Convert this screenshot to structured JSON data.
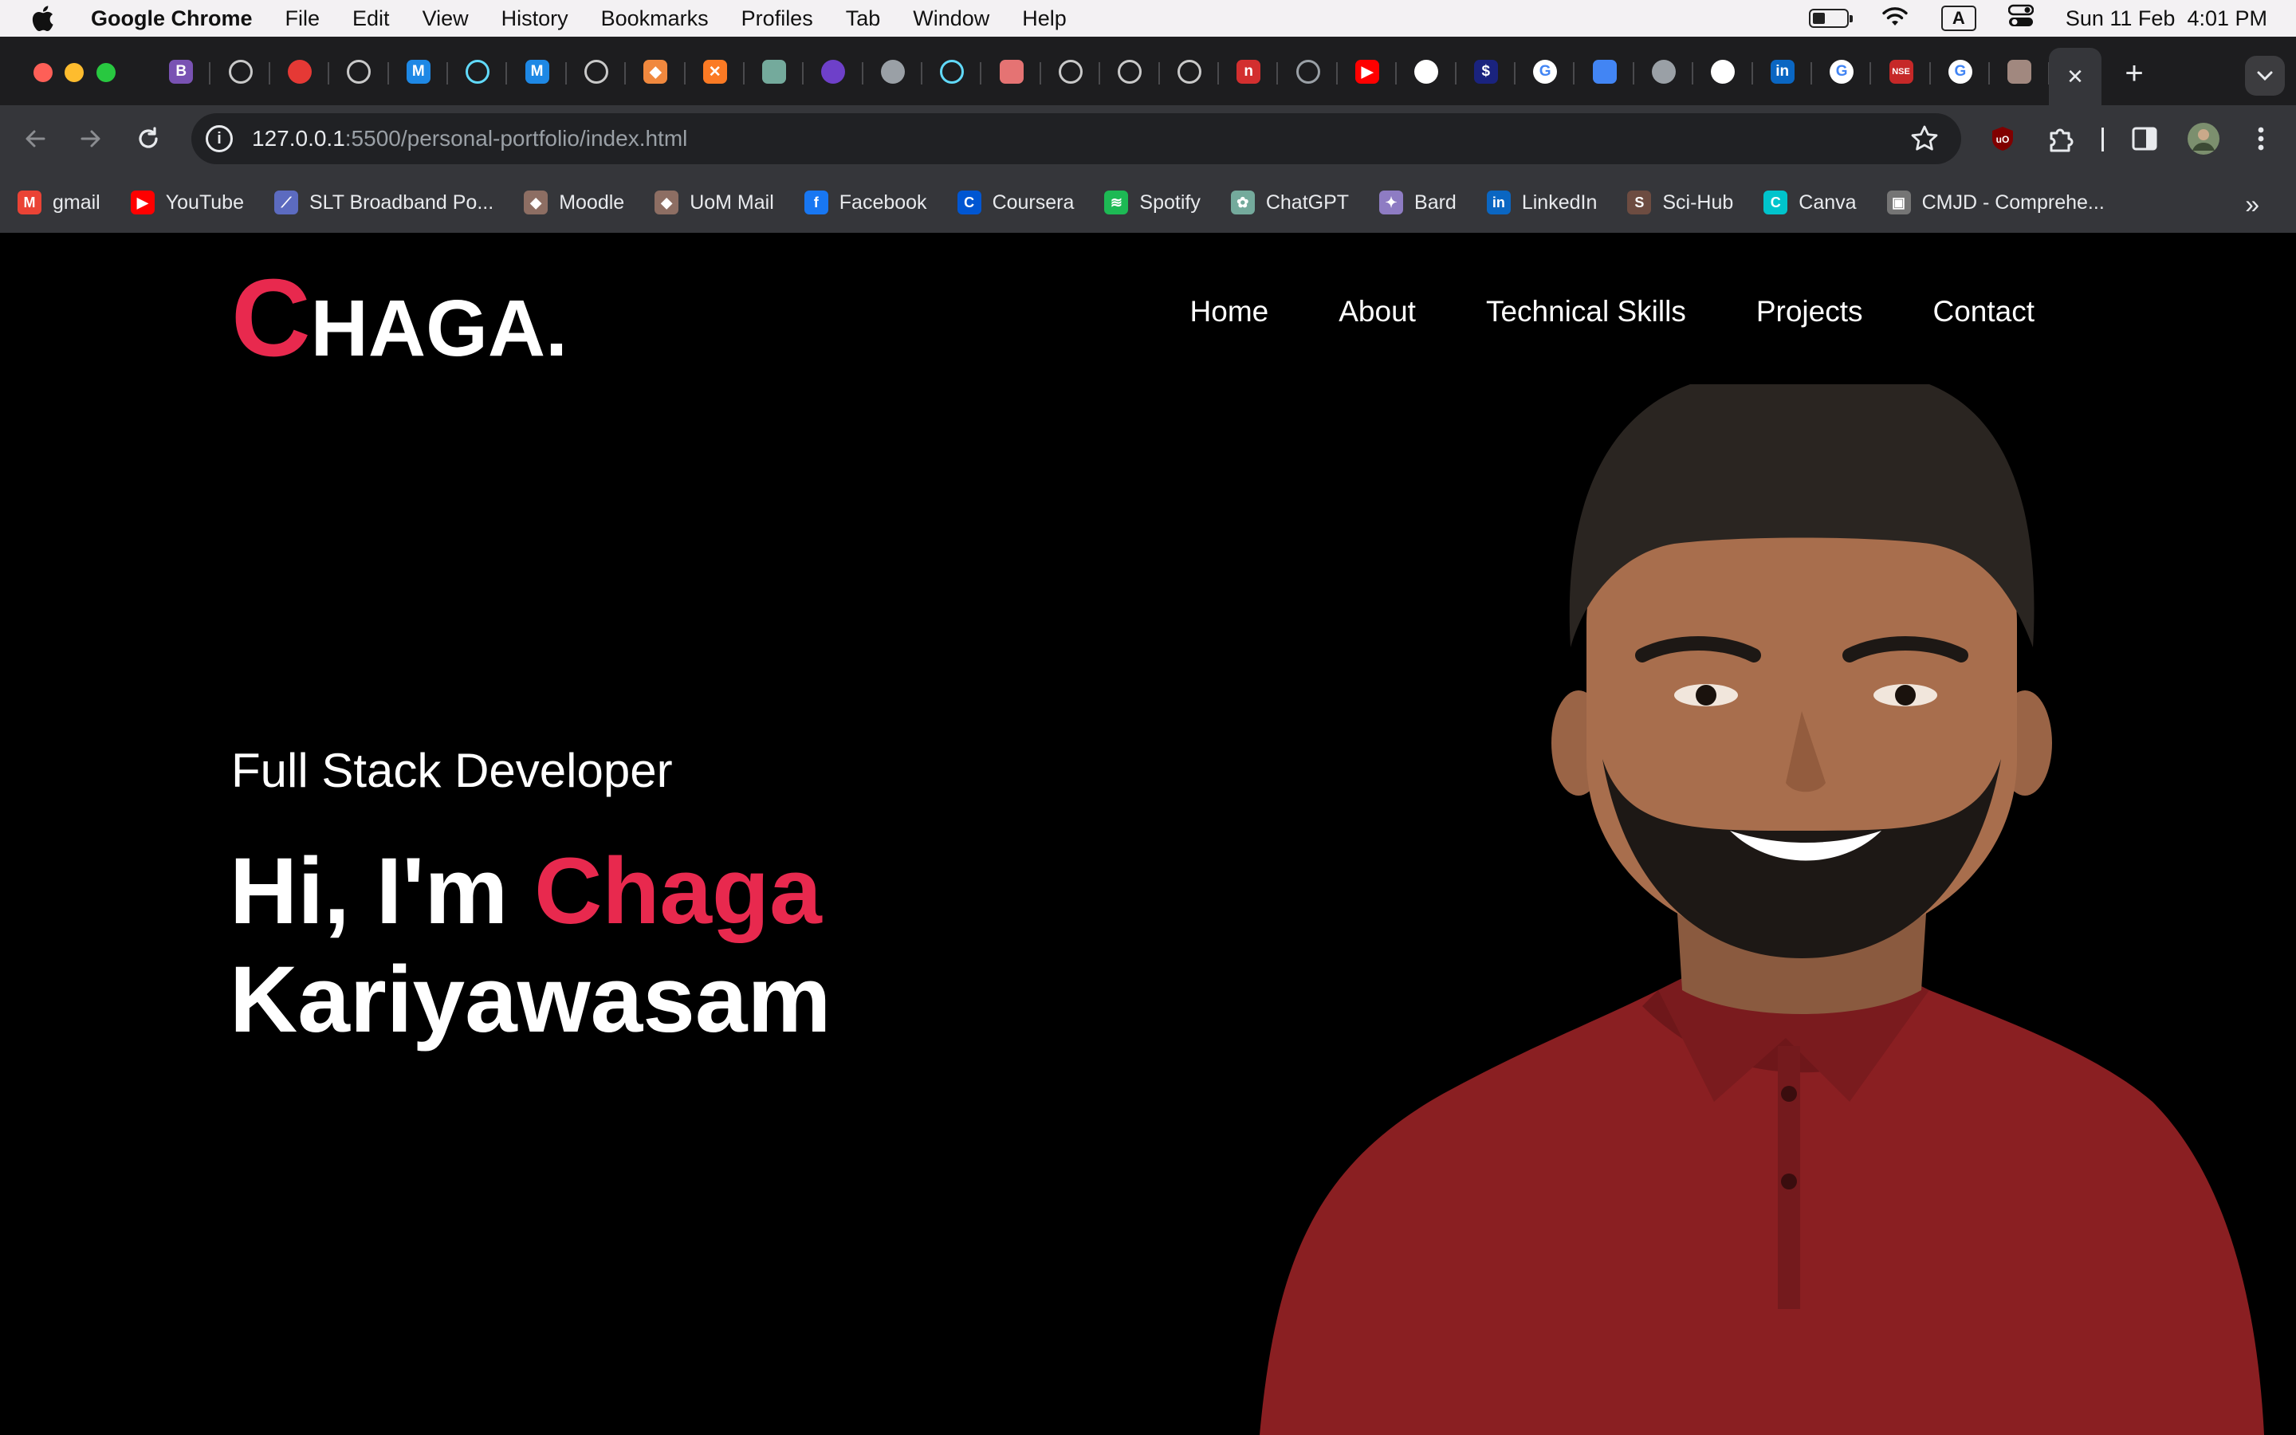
{
  "menubar": {
    "app_name": "Google Chrome",
    "menus": [
      "File",
      "Edit",
      "View",
      "History",
      "Bookmarks",
      "Profiles",
      "Tab",
      "Window",
      "Help"
    ],
    "input_source": "A",
    "clock": "Sun 11 Feb  4:01 PM",
    "battery_level": 0.35
  },
  "browser": {
    "active_tab_close": "✕",
    "new_tab": "+",
    "url_host": "127.0.0.1",
    "url_path": ":5500/personal-portfolio/index.html",
    "tab_favicons": [
      {
        "icon": "bootstrap-icon",
        "glyph": "B",
        "color": "#7952b3",
        "shape": "square"
      },
      {
        "icon": "github-icon",
        "glyph": "",
        "color": "#c9c9c9",
        "shape": "ring"
      },
      {
        "icon": "record-icon",
        "glyph": "",
        "color": "#e53935",
        "shape": "circle"
      },
      {
        "icon": "github-icon",
        "glyph": "",
        "color": "#c9c9c9",
        "shape": "ring"
      },
      {
        "icon": "mui-icon",
        "glyph": "M",
        "color": "#1e88e5",
        "shape": "square"
      },
      {
        "icon": "react-icon",
        "glyph": "",
        "color": "#61dafb",
        "shape": "ring"
      },
      {
        "icon": "mui-icon",
        "glyph": "M",
        "color": "#1e88e5",
        "shape": "square"
      },
      {
        "icon": "github-icon",
        "glyph": "",
        "color": "#c9c9c9",
        "shape": "ring"
      },
      {
        "icon": "diamond-icon",
        "glyph": "◆",
        "color": "#f0883e",
        "shape": "square"
      },
      {
        "icon": "xampp-icon",
        "glyph": "✕",
        "color": "#fb7a24",
        "shape": "square"
      },
      {
        "icon": "chatgpt-icon",
        "glyph": "",
        "color": "#74aa9c",
        "shape": "square"
      },
      {
        "icon": "spiral-icon",
        "glyph": "",
        "color": "#6e40c9",
        "shape": "circle"
      },
      {
        "icon": "globe-icon",
        "glyph": "",
        "color": "#9aa0a6",
        "shape": "circle"
      },
      {
        "icon": "react-icon",
        "glyph": "",
        "color": "#61dafb",
        "shape": "ring"
      },
      {
        "icon": "image-icon",
        "glyph": "",
        "color": "#e57373",
        "shape": "square"
      },
      {
        "icon": "gear-icon",
        "glyph": "",
        "color": "#c9c9c9",
        "shape": "ring"
      },
      {
        "icon": "list-icon",
        "glyph": "",
        "color": "#c9c9c9",
        "shape": "ring"
      },
      {
        "icon": "circle-c-icon",
        "glyph": "",
        "color": "#c9c9c9",
        "shape": "ring"
      },
      {
        "icon": "brand-n-icon",
        "glyph": "n",
        "color": "#d32f2f",
        "shape": "square"
      },
      {
        "icon": "clock-icon",
        "glyph": "",
        "color": "#9aa0a6",
        "shape": "ring"
      },
      {
        "icon": "youtube-icon",
        "glyph": "▶",
        "color": "#ff0000",
        "shape": "square"
      },
      {
        "icon": "github-icon",
        "glyph": "",
        "color": "#ffffff",
        "shape": "circle"
      },
      {
        "icon": "dollar-icon",
        "glyph": "$",
        "color": "#1a237e",
        "shape": "square"
      },
      {
        "icon": "google-icon",
        "glyph": "G",
        "color": "#ffffff",
        "shape": "circle"
      },
      {
        "icon": "docs-icon",
        "glyph": "",
        "color": "#4285f4",
        "shape": "square"
      },
      {
        "icon": "globe-icon",
        "glyph": "",
        "color": "#9aa0a6",
        "shape": "circle"
      },
      {
        "icon": "github-icon",
        "glyph": "",
        "color": "#ffffff",
        "shape": "circle"
      },
      {
        "icon": "linkedin-icon",
        "glyph": "in",
        "color": "#0a66c2",
        "shape": "square"
      },
      {
        "icon": "google-icon",
        "glyph": "G",
        "color": "#ffffff",
        "shape": "circle"
      },
      {
        "icon": "nse-icon",
        "glyph": "NSE",
        "color": "#c62828",
        "shape": "square"
      },
      {
        "icon": "google-icon",
        "glyph": "G",
        "color": "#ffffff",
        "shape": "circle"
      },
      {
        "icon": "crest-icon",
        "glyph": "",
        "color": "#a1887f",
        "shape": "square"
      }
    ],
    "bookmarks": [
      {
        "label": "gmail",
        "icon": "gmail-icon",
        "glyph": "M",
        "color": "#ea4335"
      },
      {
        "label": "YouTube",
        "icon": "youtube-icon",
        "glyph": "▶",
        "color": "#ff0000"
      },
      {
        "label": "SLT Broadband Po...",
        "icon": "slt-icon",
        "glyph": "⟋",
        "color": "#5c6bc0"
      },
      {
        "label": "Moodle",
        "icon": "moodle-icon",
        "glyph": "◆",
        "color": "#8d6e63"
      },
      {
        "label": "UoM Mail",
        "icon": "uom-icon",
        "glyph": "◆",
        "color": "#8d6e63"
      },
      {
        "label": "Facebook",
        "icon": "facebook-icon",
        "glyph": "f",
        "color": "#1877f2"
      },
      {
        "label": "Coursera",
        "icon": "coursera-icon",
        "glyph": "C",
        "color": "#0056d2"
      },
      {
        "label": "Spotify",
        "icon": "spotify-icon",
        "glyph": "≋",
        "color": "#1db954"
      },
      {
        "label": "ChatGPT",
        "icon": "chatgpt-icon",
        "glyph": "✿",
        "color": "#74aa9c"
      },
      {
        "label": "Bard",
        "icon": "bard-icon",
        "glyph": "✦",
        "color": "#8e7cc3"
      },
      {
        "label": "LinkedIn",
        "icon": "linkedin-icon",
        "glyph": "in",
        "color": "#0a66c2"
      },
      {
        "label": "Sci-Hub",
        "icon": "scihub-icon",
        "glyph": "S",
        "color": "#6d4c41"
      },
      {
        "label": "Canva",
        "icon": "canva-icon",
        "glyph": "C",
        "color": "#00c4cc"
      },
      {
        "label": "CMJD - Comprehe...",
        "icon": "cmjd-icon",
        "glyph": "▣",
        "color": "#757575"
      }
    ],
    "bookmarks_more": "»"
  },
  "page": {
    "logo_first": "C",
    "logo_rest": "HAGA.",
    "nav": [
      "Home",
      "About",
      "Technical Skills",
      "Projects",
      "Contact"
    ],
    "subtitle": "Full Stack Developer",
    "greeting": "Hi, I'm",
    "first_name": "Chaga",
    "last_name": "Kariyawasam"
  },
  "colors": {
    "accent": "#e8294e",
    "page_bg": "#000000",
    "chrome_toolbar": "#35363a",
    "shirt": "#8a1f22"
  }
}
